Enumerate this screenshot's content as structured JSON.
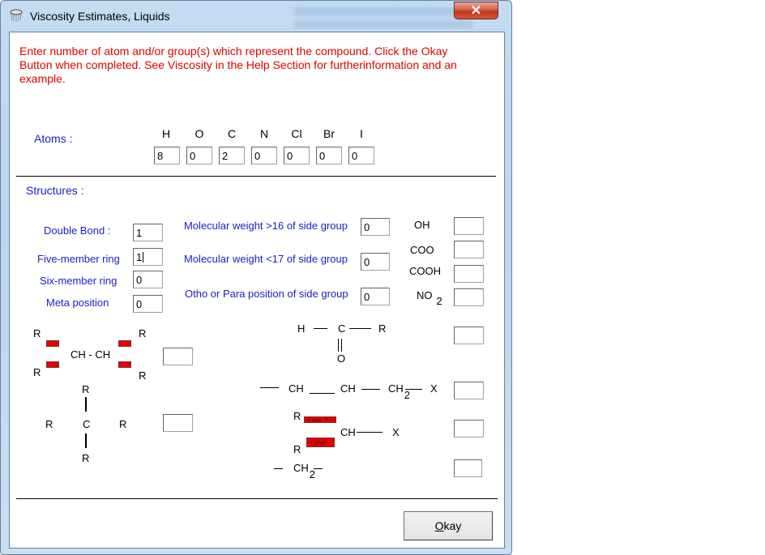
{
  "window": {
    "title": "Viscosity Estimates, Liquids",
    "close_glyph": "✕",
    "icon": "viscosity-app-icon"
  },
  "instructions": "Enter number of  atom and/or group(s) which represent the compound.  Click the Okay Button when completed. See Viscosity in the Help Section for furtherinformation and an example.",
  "atoms": {
    "label": "Atoms :",
    "fields": [
      {
        "symbol": "H",
        "value": "8"
      },
      {
        "symbol": "O",
        "value": "0"
      },
      {
        "symbol": "C",
        "value": "2"
      },
      {
        "symbol": "N",
        "value": "0"
      },
      {
        "symbol": "Cl",
        "value": "0"
      },
      {
        "symbol": "Br",
        "value": "0"
      },
      {
        "symbol": "I",
        "value": "0"
      }
    ]
  },
  "structures": {
    "label": "Structures :",
    "left_fields": [
      {
        "label": "Double Bond :",
        "value": "1"
      },
      {
        "label": "Five-member ring",
        "value": "1"
      },
      {
        "label": "Six-member ring",
        "value": "0"
      },
      {
        "label": "Meta position",
        "value": "0"
      }
    ],
    "middle_fields": [
      {
        "label": "Molecular weight >16 of side group",
        "value": "0"
      },
      {
        "label": "Molecular weight <17 of side group",
        "value": "0"
      },
      {
        "label": "Otho or Para position of side group",
        "value": "0"
      }
    ],
    "groups": [
      {
        "label": "OH",
        "value": ""
      },
      {
        "label": "COO",
        "value": ""
      },
      {
        "label": "COOH",
        "value": ""
      },
      {
        "label": "NO",
        "sub": "2",
        "value": ""
      }
    ]
  },
  "diagrams": {
    "ch_ch": {
      "center": "CH - CH",
      "r": "R",
      "value": ""
    },
    "c_quat": {
      "center": "C",
      "r": "R",
      "value": ""
    },
    "aldehyde": {
      "h": "H",
      "c": "C",
      "r": "R",
      "o": "O",
      "value": ""
    },
    "chain": {
      "ch1": "CH",
      "ch2": "CH",
      "ch3": "CH",
      "sub": "2",
      "x": "X",
      "value": ""
    },
    "branch": {
      "r1": "R",
      "r2": "R",
      "ch": "CH",
      "x": "X",
      "line_label1": "Line 2",
      "line_label2": "Line",
      "value": ""
    },
    "methylene": {
      "ch": "CH",
      "sub": "2",
      "value": ""
    }
  },
  "buttons": {
    "okay_accel": "O",
    "okay_rest": "kay"
  }
}
